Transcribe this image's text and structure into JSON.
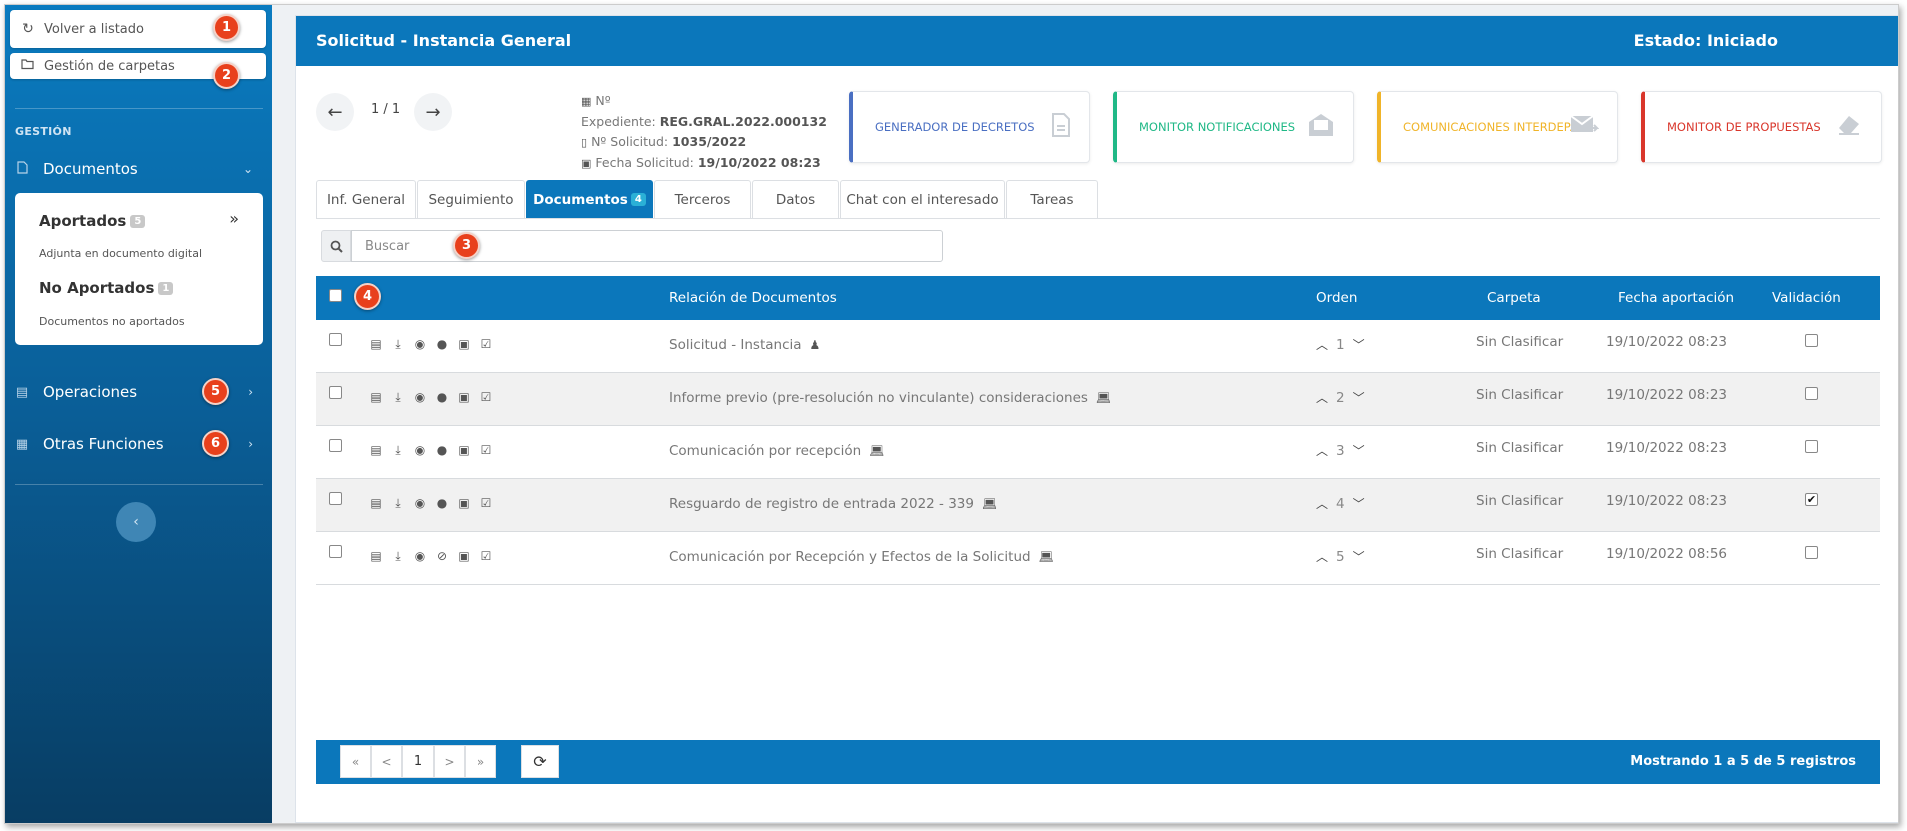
{
  "sidebar": {
    "back_label": "Volver a listado",
    "folders_label": "Gestión de carpetas",
    "section": "GESTIÓN",
    "documentos_label": "Documentos",
    "sub": {
      "aportados": "Aportados",
      "aportados_count": "5",
      "aportados_desc": "Adjunta en documento digital",
      "no_aportados": "No Aportados",
      "no_aportados_count": "1",
      "no_aportados_desc": "Documentos no aportados"
    },
    "operaciones_label": "Operaciones",
    "otras_label": "Otras Funciones"
  },
  "callouts": [
    "1",
    "2",
    "3",
    "4",
    "5",
    "6"
  ],
  "header": {
    "title": "Solicitud - Instancia General",
    "state": "Estado: Iniciado"
  },
  "pager_top": "1 / 1",
  "info": {
    "num_label": "Nº",
    "exp_label": "Expediente:",
    "exp_value": "REG.GRAL.2022.000132",
    "sol_label": "Nº Solicitud:",
    "sol_value": "1035/2022",
    "fecha_label": "Fecha Solicitud:",
    "fecha_value": "19/10/2022 08:23"
  },
  "cards": [
    {
      "label": "GENERADOR DE DECRETOS",
      "color": "#4a6fc2"
    },
    {
      "label": "MONITOR NOTIFICACIONES",
      "color": "#1fb886"
    },
    {
      "label": "COMUNICACIONES INTERDEP.",
      "color": "#f0b429"
    },
    {
      "label": "MONITOR DE PROPUESTAS",
      "color": "#d9362b"
    }
  ],
  "tabs": [
    "Inf. General",
    "Seguimiento",
    "Documentos",
    "Terceros",
    "Datos",
    "Chat con el interesado",
    "Tareas"
  ],
  "tab_docs_count": "4",
  "search": {
    "placeholder": "Buscar"
  },
  "table": {
    "headers": {
      "relacion": "Relación de Documentos",
      "orden": "Orden",
      "carpeta": "Carpeta",
      "fecha": "Fecha aportación",
      "validacion": "Validación"
    },
    "rows": [
      {
        "name": "Solicitud - Instancia",
        "orden": "1",
        "carpeta": "Sin Clasificar",
        "fecha": "19/10/2022 08:23",
        "validado": false
      },
      {
        "name": "Informe previo (pre-resolución no vinculante) consideraciones",
        "orden": "2",
        "carpeta": "Sin Clasificar",
        "fecha": "19/10/2022 08:23",
        "validado": false
      },
      {
        "name": "Comunicación por recepción",
        "orden": "3",
        "carpeta": "Sin Clasificar",
        "fecha": "19/10/2022 08:23",
        "validado": false
      },
      {
        "name": "Resguardo de registro de entrada 2022 - 339",
        "orden": "4",
        "carpeta": "Sin Clasificar",
        "fecha": "19/10/2022 08:23",
        "validado": true
      },
      {
        "name": "Comunicación por Recepción y Efectos de la Solicitud",
        "orden": "5",
        "carpeta": "Sin Clasificar",
        "fecha": "19/10/2022 08:56",
        "validado": false
      }
    ]
  },
  "footer": {
    "first": "«",
    "prev": "<",
    "page": "1",
    "next": ">",
    "last": "»",
    "showing": "Mostrando 1 a 5 de 5 registros"
  }
}
